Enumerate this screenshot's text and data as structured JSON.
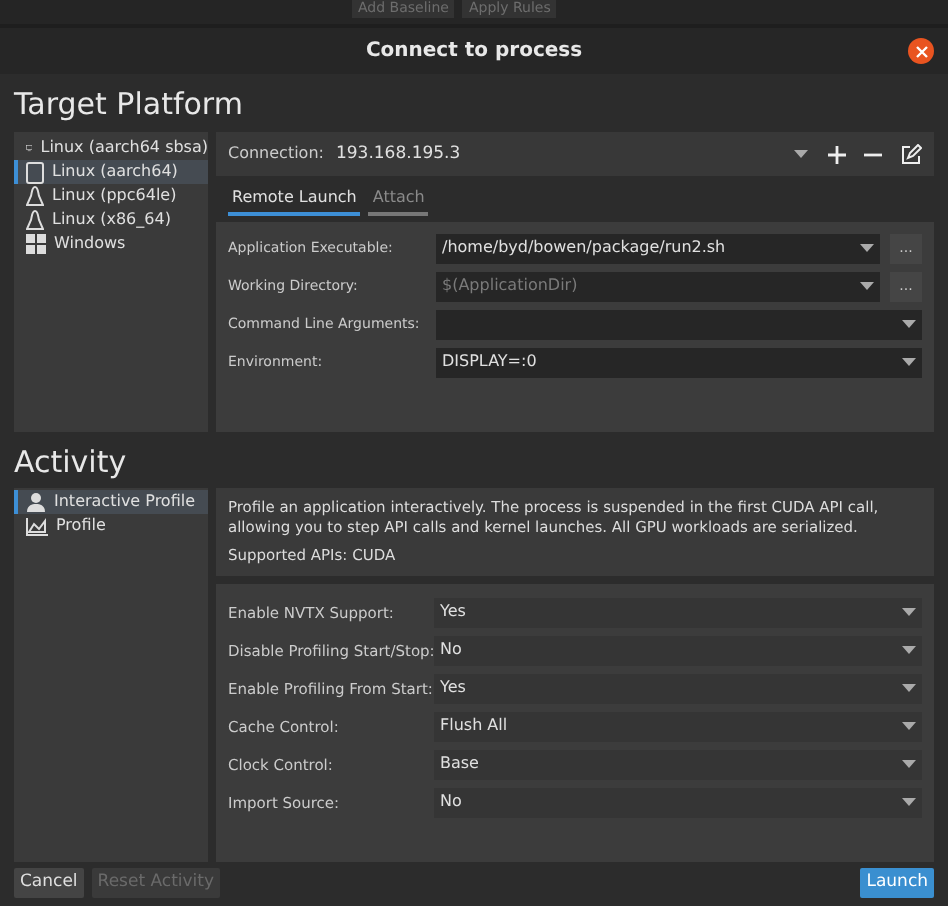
{
  "toolbar": {
    "buttons": [
      "Add Baseline",
      "Apply Rules"
    ]
  },
  "window": {
    "title": "Connect to process"
  },
  "target_platform": {
    "heading": "Target Platform",
    "platforms": [
      {
        "label": "Linux (aarch64 sbsa)",
        "kind": "monitor",
        "selected": false
      },
      {
        "label": "Linux (aarch64)",
        "kind": "device",
        "selected": true
      },
      {
        "label": "Linux (ppc64le)",
        "kind": "penguin",
        "selected": false
      },
      {
        "label": "Linux (x86_64)",
        "kind": "penguin",
        "selected": false
      },
      {
        "label": "Windows",
        "kind": "windows",
        "selected": false
      }
    ],
    "connection": {
      "label": "Connection:",
      "value": "193.168.195.3"
    },
    "tabs": [
      {
        "label": "Remote Launch",
        "selected": true
      },
      {
        "label": "Attach",
        "selected": false
      }
    ],
    "fields": [
      {
        "label": "Application Executable:",
        "value": "/home/byd/bowen/package/run2.sh",
        "browse": "..."
      },
      {
        "label": "Working Directory:",
        "placeholder": "$(ApplicationDir)",
        "browse": "..."
      },
      {
        "label": "Command Line Arguments:"
      },
      {
        "label": "Environment:",
        "value": "DISPLAY=:0"
      }
    ]
  },
  "activity": {
    "heading": "Activity",
    "items": [
      {
        "label": "Interactive Profile",
        "kind": "user",
        "selected": true
      },
      {
        "label": "Profile",
        "kind": "chart",
        "selected": false
      }
    ],
    "description": "Profile an application interactively. The process is suspended in the first CUDA API call, allowing you to step API calls and kernel launches. All GPU workloads are serialized.",
    "supported_apis": "Supported APIs: CUDA",
    "options": [
      {
        "label": "Enable NVTX Support:",
        "value": "Yes"
      },
      {
        "label": "Disable Profiling Start/Stop:",
        "value": "No"
      },
      {
        "label": "Enable Profiling From Start:",
        "value": "Yes"
      },
      {
        "label": "Cache Control:",
        "value": "Flush All"
      },
      {
        "label": "Clock Control:",
        "value": "Base"
      },
      {
        "label": "Import Source:",
        "value": "No"
      }
    ]
  },
  "footer": {
    "cancel": {
      "label": "Cancel",
      "disabled": false
    },
    "reset": {
      "label": "Reset Activity",
      "disabled": true
    },
    "launch": {
      "label": "Launch",
      "disabled": false
    }
  }
}
